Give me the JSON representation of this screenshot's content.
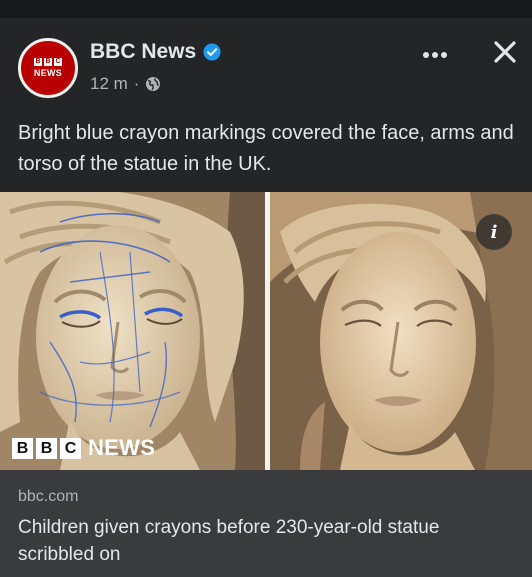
{
  "post": {
    "page_name": "BBC News",
    "avatar_text": {
      "blocks": [
        "B",
        "B",
        "C"
      ],
      "word": "NEWS"
    },
    "time": "12 m",
    "separator": "·",
    "audience_icon": "globe-icon",
    "verified_icon": "verified-badge-icon",
    "caption": "Bright blue crayon markings covered the face, arms and torso of the statue in the UK."
  },
  "actions": {
    "more_icon": "more-options-icon",
    "close_icon": "close-icon"
  },
  "media": {
    "watermark_blocks": [
      "B",
      "B",
      "C"
    ],
    "watermark_word": "NEWS",
    "info_label": "i"
  },
  "link": {
    "domain": "bbc.com",
    "headline": "Children given crayons before 230-year-old statue scribbled on"
  },
  "colors": {
    "background": "#242526",
    "link_box": "#3a3b3c",
    "bbc_red": "#b80000",
    "verified_blue": "#1d9bf0",
    "crayon_blue": "#3a5fc8"
  }
}
